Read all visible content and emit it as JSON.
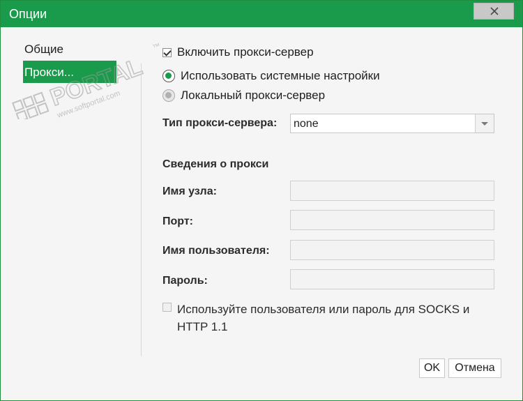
{
  "window": {
    "title": "Опции"
  },
  "sidebar": {
    "items": [
      {
        "label": "Общие",
        "active": false
      },
      {
        "label": "Прокси...",
        "active": true
      }
    ]
  },
  "proxy": {
    "enable_label": "Включить прокси-сервер",
    "enable_checked": true,
    "radio_system": "Использовать системные настройки",
    "radio_local": "Локальный прокси-сервер",
    "type_label": "Тип прокси-сервера:",
    "type_value": "none",
    "details_heading": "Сведения о прокси",
    "host_label": "Имя узла:",
    "host_value": "",
    "port_label": "Порт:",
    "port_value": "",
    "user_label": "Имя пользователя:",
    "user_value": "",
    "password_label": "Пароль:",
    "password_value": "",
    "socks_label": "Используйте пользователя или пароль для SOCKS и HTTP 1.1"
  },
  "buttons": {
    "ok": "OK",
    "cancel": "Отмена"
  },
  "watermark": {
    "text": "PORTAL",
    "subtext": "www.softportal.com",
    "tm": "™"
  },
  "colors": {
    "accent": "#1a9b4b",
    "titlebar_text": "#ffffff",
    "close_button": "#c8c8c8"
  },
  "icons": {
    "close": "close-icon",
    "dropdown": "chevron-down-icon"
  }
}
